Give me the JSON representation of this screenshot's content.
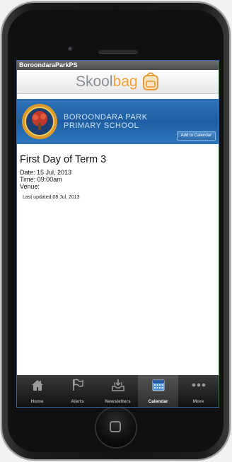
{
  "app": {
    "title_bar": "BoroondaraParkPS",
    "brand": {
      "name_part1": "Skool",
      "name_part2": "bag"
    }
  },
  "banner": {
    "school_line1": "BOROONDARA PARK",
    "school_line2": "PRIMARY SCHOOL",
    "add_to_calendar": "Add to Calendar"
  },
  "event": {
    "title": "First Day of Term 3",
    "date": "Date: 15 Jul, 2013",
    "time": "Time: 09:00am",
    "venue": "Venue:",
    "last_updated": "Last updated:08 Jul, 2013"
  },
  "tabs": [
    {
      "label": "Home",
      "icon": "home-icon"
    },
    {
      "label": "Alerts",
      "icon": "flag-icon"
    },
    {
      "label": "Newsletters",
      "icon": "inbox-download-icon"
    },
    {
      "label": "Calendar",
      "icon": "calendar-icon",
      "active": true
    },
    {
      "label": "More",
      "icon": "more-dots-icon"
    }
  ],
  "colors": {
    "banner_blue": "#1f5ea3",
    "brand_orange": "#f0a33a",
    "tabbar_dark": "#1a1a1a"
  }
}
